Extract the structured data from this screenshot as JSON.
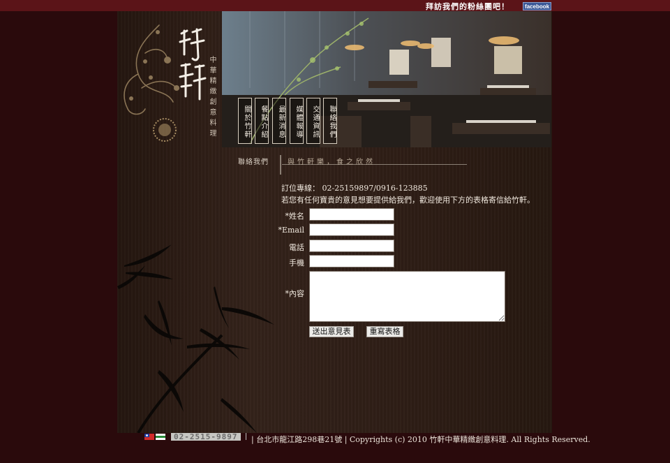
{
  "header": {
    "fans_link": "拜訪我們的粉絲團吧！",
    "facebook_badge": "facebook"
  },
  "brand": {
    "tagline": "中華精緻創意料理"
  },
  "nav": {
    "items": [
      "關於竹軒",
      "餐點介紹",
      "最新消息",
      "媒體報導",
      "交通資訊",
      "聯絡我們"
    ]
  },
  "breadcrumb": {
    "current": "聯絡我們",
    "slogan": "與竹軒樂，食之欣然"
  },
  "contact": {
    "phone_line": "訂位專線： 02-25159897/0916-123885",
    "intro": "若您有任何寶貴的意見想要提供給我們，歡迎使用下方的表格寄信給竹軒。"
  },
  "form": {
    "name_label": "*姓名",
    "email_label": "*Email",
    "tel_label": "電話",
    "mobile_label": "手機",
    "content_label": "*內容",
    "name_value": "",
    "email_value": "",
    "tel_value": "",
    "mobile_value": "",
    "content_value": "",
    "submit_label": "送出意見表",
    "reset_label": "重寫表格"
  },
  "footer": {
    "phone_badge": "02-2515-9897",
    "text": "| 台北市龍江路298巷21號 | Copyrights (c) 2010 竹軒中華精緻創意料理. All Rights Reserved."
  },
  "colors": {
    "page_bg": "#2a0a0c",
    "top_bar": "#5b1418",
    "facebook": "#3b5998"
  },
  "icons": [
    "vine-ornament-icon",
    "calligraphy-logo",
    "bamboo-decoration",
    "flag-icons",
    "restaurant-photo"
  ]
}
